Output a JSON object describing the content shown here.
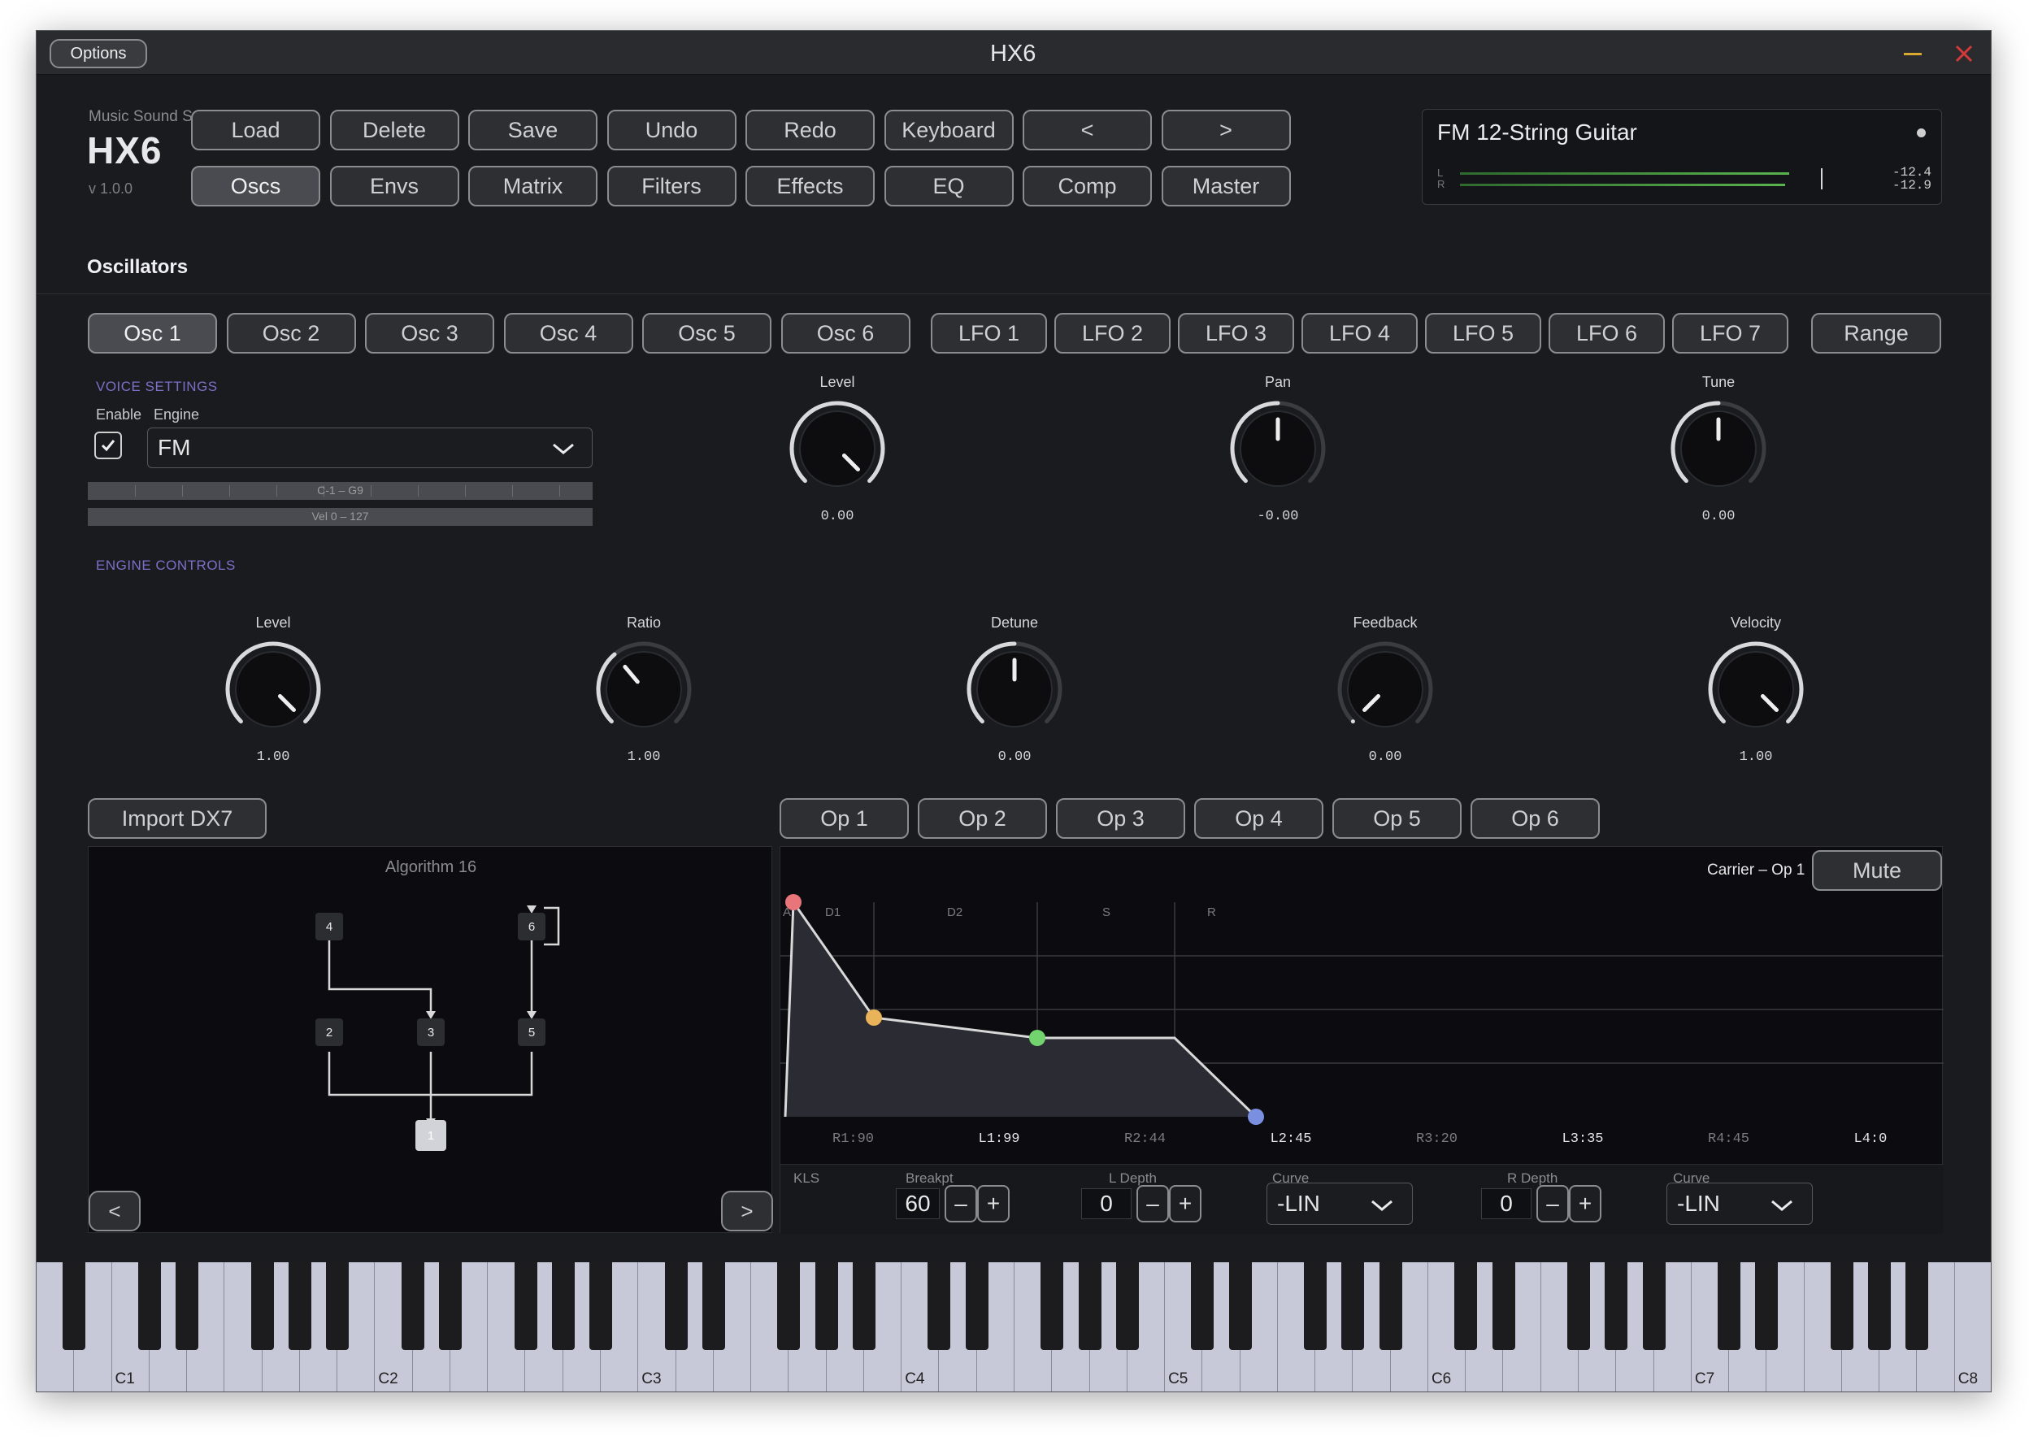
{
  "window": {
    "title": "HX6",
    "options_label": "Options"
  },
  "brand": {
    "company": "Music Sound Software",
    "product": "HX6",
    "version": "v 1.0.0"
  },
  "toolbar_top": [
    "Load",
    "Delete",
    "Save",
    "Undo",
    "Redo",
    "Keyboard",
    "<",
    ">"
  ],
  "toolbar_pages": [
    "Oscs",
    "Envs",
    "Matrix",
    "Filters",
    "Effects",
    "EQ",
    "Comp",
    "Master"
  ],
  "active_page": "Oscs",
  "preset": {
    "name": "FM 12-String Guitar",
    "meter_l_label": "L",
    "meter_r_label": "R",
    "level_l": "-12.4",
    "level_r": "-12.9"
  },
  "section_title": "Oscillators",
  "osc_tabs": [
    "Osc 1",
    "Osc 2",
    "Osc 3",
    "Osc 4",
    "Osc 5",
    "Osc 6"
  ],
  "lfo_tabs": [
    "LFO 1",
    "LFO 2",
    "LFO 3",
    "LFO 4",
    "LFO 5",
    "LFO 6",
    "LFO 7"
  ],
  "range_label": "Range",
  "voice": {
    "heading": "VOICE SETTINGS",
    "enable_label": "Enable",
    "engine_label": "Engine",
    "engine_value": "FM",
    "enabled": true,
    "key_range": "C-1 – G9",
    "vel_range": "Vel 0 – 127"
  },
  "osc_knobs": [
    {
      "label": "Level",
      "value": "0.00"
    },
    {
      "label": "Pan",
      "value": "-0.00"
    },
    {
      "label": "Tune",
      "value": "0.00"
    }
  ],
  "engine": {
    "heading": "ENGINE CONTROLS"
  },
  "engine_knobs": [
    {
      "label": "Level",
      "value": "1.00"
    },
    {
      "label": "Ratio",
      "value": "1.00"
    },
    {
      "label": "Detune",
      "value": "0.00"
    },
    {
      "label": "Feedback",
      "value": "0.00"
    },
    {
      "label": "Velocity",
      "value": "1.00"
    }
  ],
  "import_label": "Import DX7",
  "op_tabs": [
    "Op 1",
    "Op 2",
    "Op 3",
    "Op 4",
    "Op 5",
    "Op 6"
  ],
  "algorithm": {
    "title": "Algorithm 16",
    "nodes": [
      "4",
      "6",
      "2",
      "3",
      "5",
      "1"
    ],
    "prev": "<",
    "next": ">"
  },
  "envelope": {
    "title": "Carrier – Op 1",
    "mute_label": "Mute",
    "stages": [
      "A",
      "D1",
      "D2",
      "S",
      "R"
    ],
    "params": [
      "R1:90",
      "L1:99",
      "R2:44",
      "L2:45",
      "R3:20",
      "L3:35",
      "R4:45",
      "L4:0"
    ]
  },
  "kls": {
    "label": "KLS",
    "breakpt_label": "Breakpt",
    "breakpt": "60",
    "ldepth_label": "L  Depth",
    "ldepth": "0",
    "lcurve_label": "Curve",
    "lcurve": "-LIN",
    "rdepth_label": "R  Depth",
    "rdepth": "0",
    "rcurve_label": "Curve",
    "rcurve": "-LIN",
    "minus": "–",
    "plus": "+"
  },
  "keyboard": {
    "labels": [
      "C1",
      "C2",
      "C3",
      "C4",
      "C5",
      "C6",
      "C7",
      "C8"
    ]
  },
  "colors": {
    "bg": "#1a1b1e",
    "accent": "#7a70c8",
    "attack": "#e8757a",
    "decay1": "#e9b35a",
    "decay2": "#72d36f",
    "release": "#7b8fe0"
  }
}
